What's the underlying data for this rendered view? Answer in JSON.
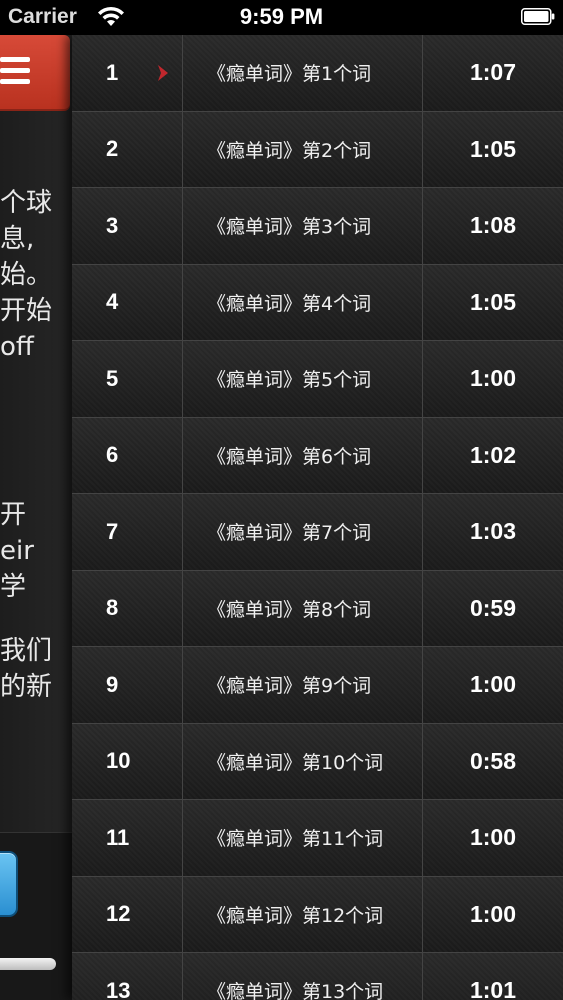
{
  "status_bar": {
    "carrier": "Carrier",
    "time": "9:59 PM"
  },
  "side_panel": {
    "text_block_1": [
      "个球",
      "息,",
      "始。",
      "开始",
      "off"
    ],
    "text_block_2": [
      "开",
      "eir",
      "学"
    ],
    "text_block_3": [
      "我们",
      "的新"
    ]
  },
  "colors": {
    "accent_red": "#c93a27",
    "play_indicator": "#c0272d",
    "blue_button": "#3aa3e2"
  },
  "tracks": [
    {
      "number": "1",
      "title": "《瘾单词》第1个词",
      "duration": "1:07",
      "playing": true
    },
    {
      "number": "2",
      "title": "《瘾单词》第2个词",
      "duration": "1:05",
      "playing": false
    },
    {
      "number": "3",
      "title": "《瘾单词》第3个词",
      "duration": "1:08",
      "playing": false
    },
    {
      "number": "4",
      "title": "《瘾单词》第4个词",
      "duration": "1:05",
      "playing": false
    },
    {
      "number": "5",
      "title": "《瘾单词》第5个词",
      "duration": "1:00",
      "playing": false
    },
    {
      "number": "6",
      "title": "《瘾单词》第6个词",
      "duration": "1:02",
      "playing": false
    },
    {
      "number": "7",
      "title": "《瘾单词》第7个词",
      "duration": "1:03",
      "playing": false
    },
    {
      "number": "8",
      "title": "《瘾单词》第8个词",
      "duration": "0:59",
      "playing": false
    },
    {
      "number": "9",
      "title": "《瘾单词》第9个词",
      "duration": "1:00",
      "playing": false
    },
    {
      "number": "10",
      "title": "《瘾单词》第10个词",
      "duration": "0:58",
      "playing": false
    },
    {
      "number": "11",
      "title": "《瘾单词》第11个词",
      "duration": "1:00",
      "playing": false
    },
    {
      "number": "12",
      "title": "《瘾单词》第12个词",
      "duration": "1:00",
      "playing": false
    },
    {
      "number": "13",
      "title": "《瘾单词》第13个词",
      "duration": "1:01",
      "playing": false
    }
  ]
}
